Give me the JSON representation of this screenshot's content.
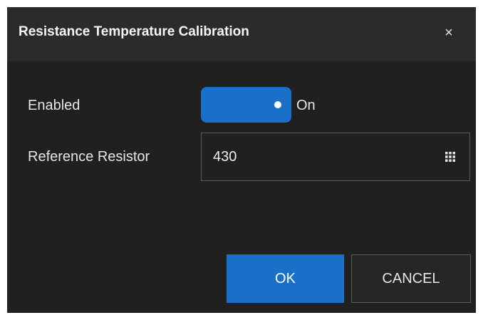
{
  "dialog": {
    "title": "Resistance Temperature Calibration",
    "close_glyph": "×",
    "close_icon": "close-icon"
  },
  "fields": {
    "enabled": {
      "label": "Enabled",
      "state": "On",
      "checked": true
    },
    "reference_resistor": {
      "label": "Reference Resistor",
      "value": "430",
      "icon": "keypad-icon"
    }
  },
  "buttons": {
    "ok": "OK",
    "cancel": "CANCEL"
  },
  "colors": {
    "accent": "#1a6fc9",
    "background": "#202020",
    "titlebar": "#2b2b2b",
    "text": "#e6e6e6"
  }
}
